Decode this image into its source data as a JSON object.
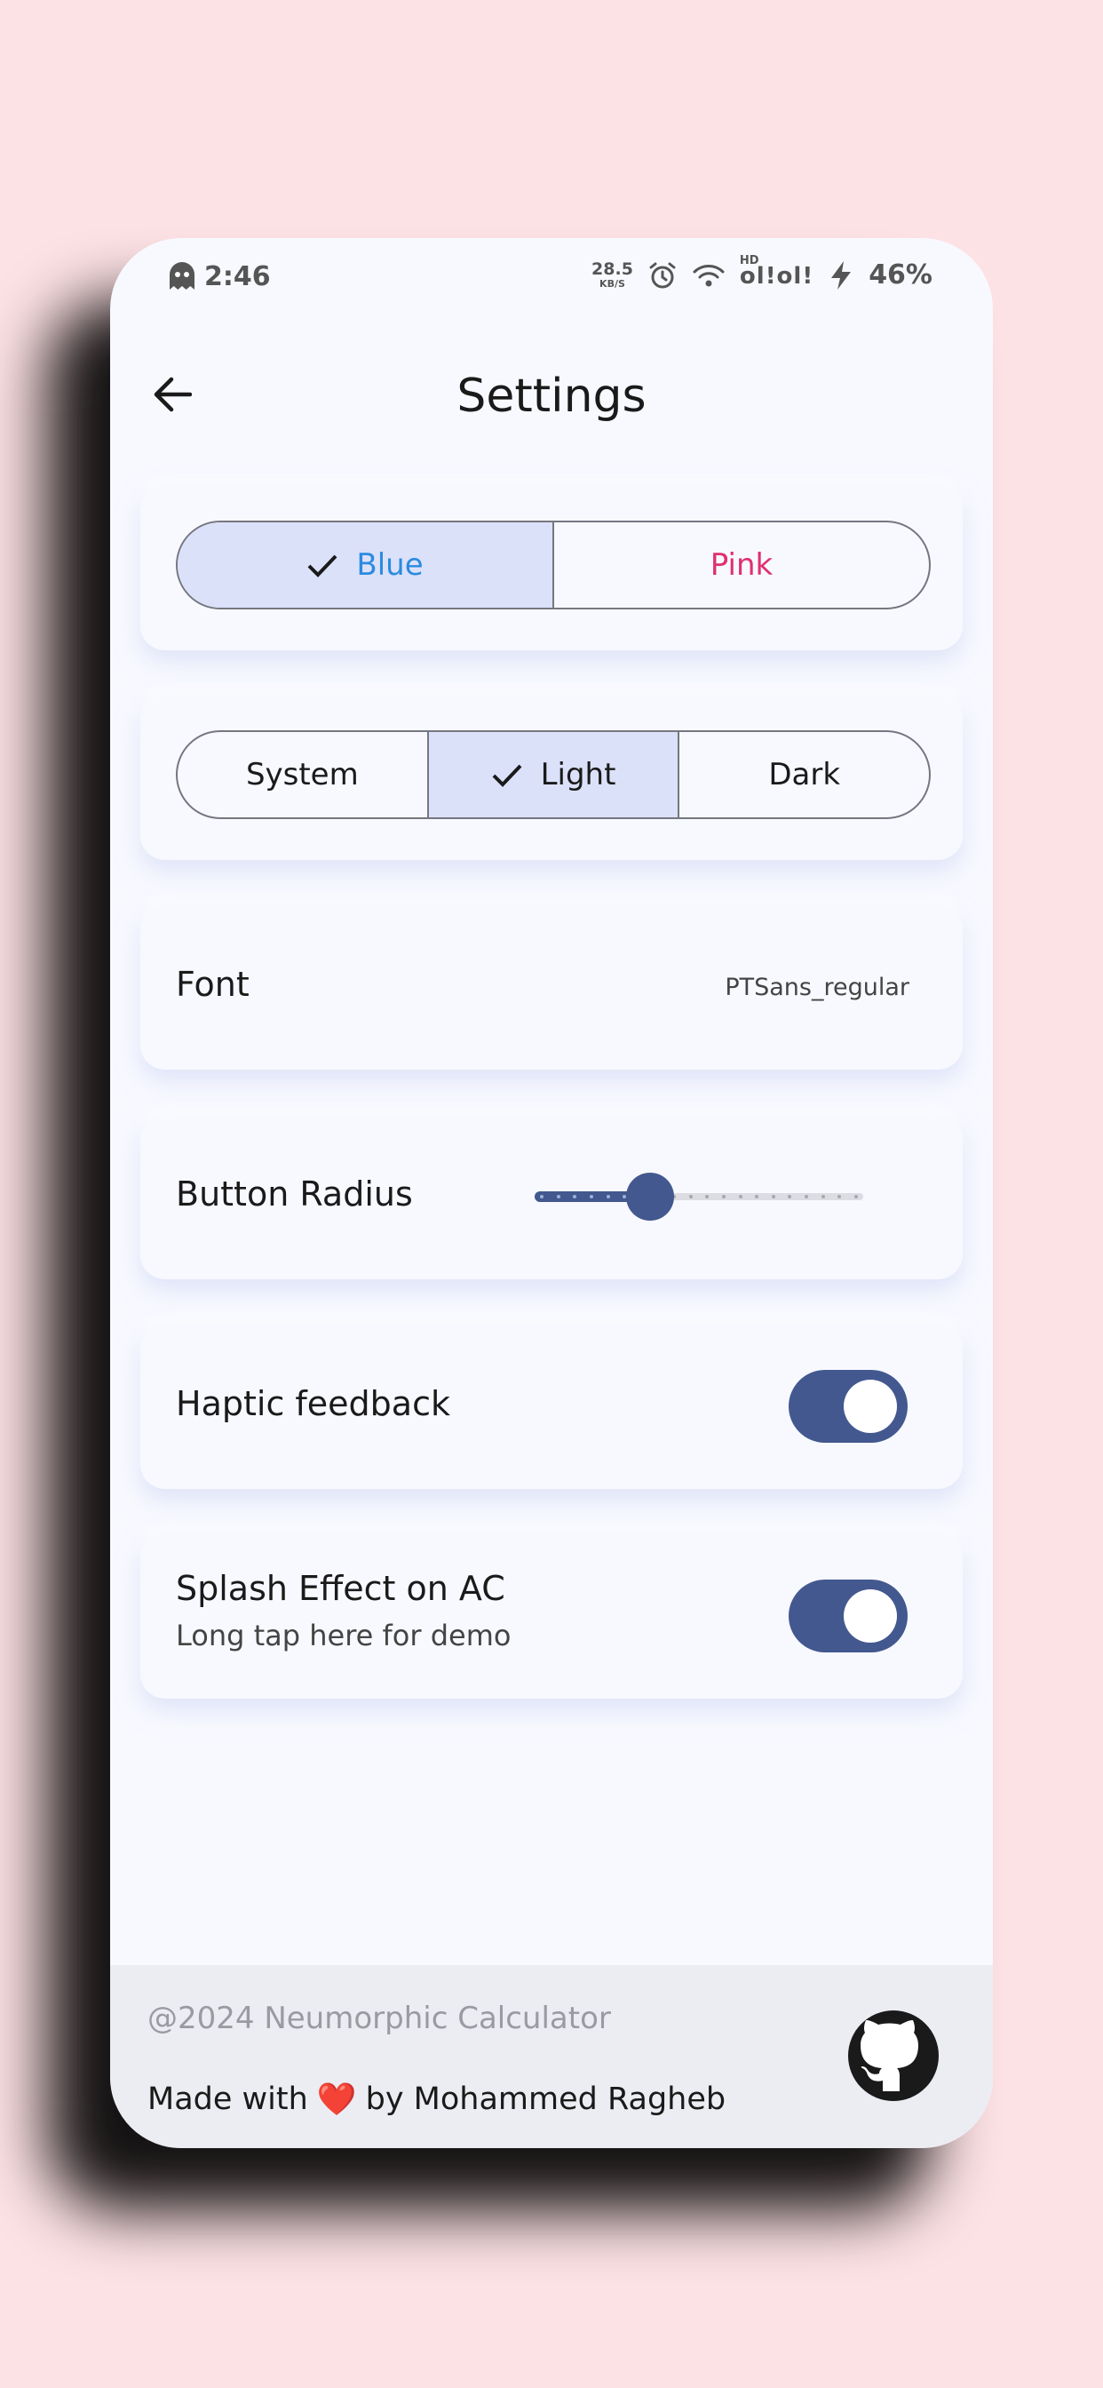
{
  "status_bar": {
    "time": "2:46",
    "net_speed_value": "28.5",
    "net_speed_unit": "KB/S",
    "hd_label": "HD",
    "signal_text": "ol!ol!",
    "battery": "46%"
  },
  "header": {
    "title": "Settings"
  },
  "theme_color": {
    "options": [
      "Blue",
      "Pink"
    ],
    "selected": "Blue",
    "option_colors": [
      "#2b8be0",
      "#e0306f"
    ]
  },
  "theme_mode": {
    "options": [
      "System",
      "Light",
      "Dark"
    ],
    "selected": "Light"
  },
  "font_row": {
    "label": "Font",
    "value": "PTSans_regular"
  },
  "radius_row": {
    "label": "Button Radius",
    "slider_fraction": 0.35,
    "tick_count": 20
  },
  "haptic_row": {
    "label": "Haptic feedback",
    "enabled": true
  },
  "splash_row": {
    "label": "Splash Effect on AC",
    "sublabel": "Long tap here for demo",
    "enabled": true
  },
  "footer": {
    "copyright": "@2024 Neumorphic Calculator",
    "made_with_prefix": "Made with",
    "heart": "❤️",
    "made_with_suffix": "by Mohammed Ragheb"
  },
  "colors": {
    "accent": "#43588f",
    "selected_segment": "#dce1fa",
    "page_background": "#fde2e5"
  }
}
